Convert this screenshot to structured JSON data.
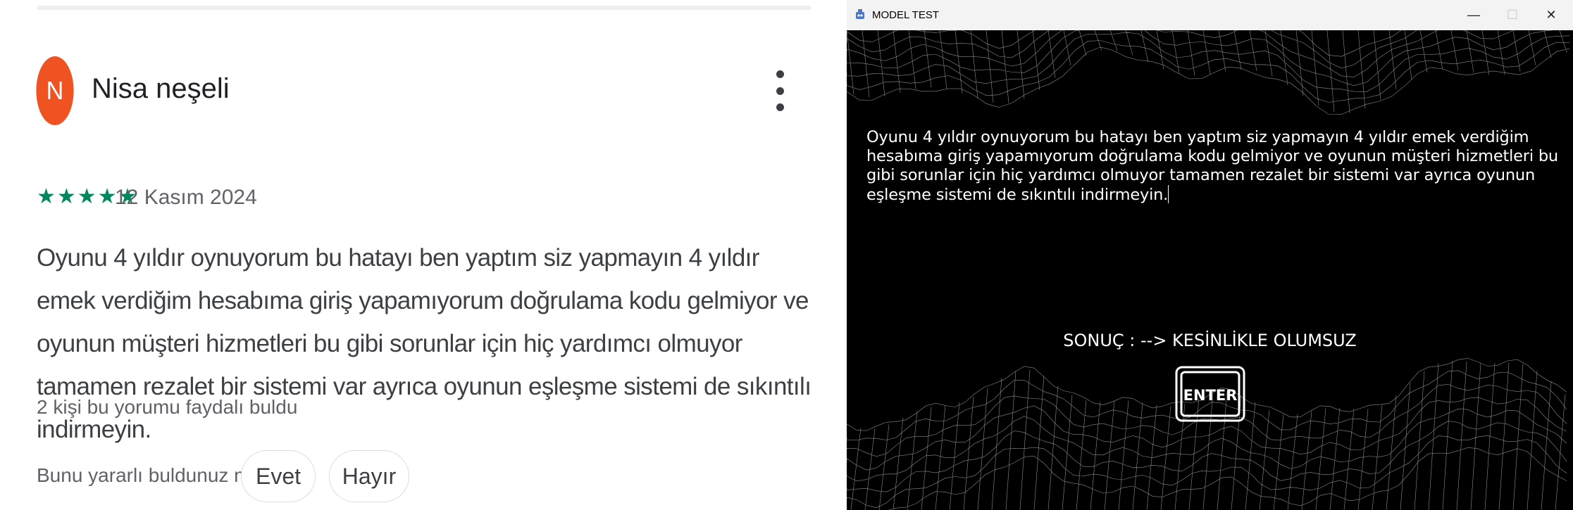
{
  "review": {
    "avatar_initial": "N",
    "author_name": "Nisa neşeli",
    "rating_stars": "★★★★★",
    "rating": 5,
    "date": "12 Kasım 2024",
    "text": "Oyunu 4 yıldır oynuyorum bu hatayı ben yaptım siz yapmayın 4 yıldır emek verdiğim hesabıma giriş yapamıyorum doğrulama kodu gelmiyor ve oyunun müşteri hizmetleri bu gibi sorunlar için hiç yardımcı olmuyor tamamen rezalet bir sistemi var ayrıca oyunun eşleşme sistemi de sıkıntılı indirmeyin.",
    "helpful_count_text": "2 kişi bu yorumu faydalı buldu",
    "helpful_question": "Bunu yararlı buldunuz mu?",
    "yes_label": "Evet",
    "no_label": "Hayır",
    "avatar_color": "#ef5322",
    "star_color": "#01875f"
  },
  "window": {
    "title": "MODEL TEST",
    "minimize_glyph": "—",
    "maximize_glyph": "☐",
    "close_glyph": "✕",
    "input_text": "Oyunu 4 yıldır oynuyorum bu hatayı ben yaptım siz yapmayın 4 yıldır emek verdiğim hesabıma giriş yapamıyorum doğrulama kodu gelmiyor ve oyunun müşteri hizmetleri bu gibi sorunlar için hiç yardımcı olmuyor tamamen rezalet bir sistemi var ayrıca oyunun eşleşme sistemi de sıkıntılı indirmeyin.",
    "result_text": "SONUÇ :  --> KESİNLİKLE OLUMSUZ",
    "enter_label": "ENTER",
    "background": "#000000"
  }
}
